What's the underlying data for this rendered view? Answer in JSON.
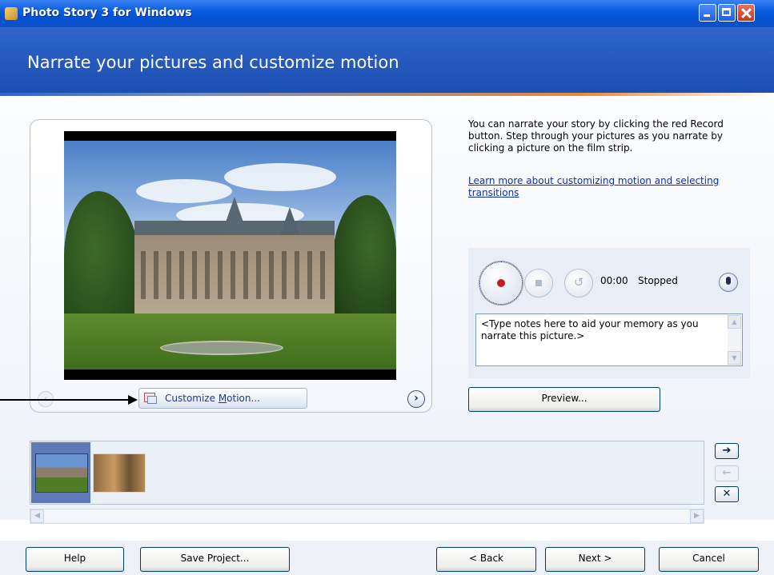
{
  "window": {
    "title": "Photo Story 3 for Windows",
    "controls": {
      "minimize": "minimize-icon",
      "maximize": "maximize-icon",
      "close": "close-icon"
    }
  },
  "header": {
    "title": "Narrate your pictures and customize motion"
  },
  "preview": {
    "customize_label_prefix": "Customize ",
    "customize_label_accel": "M",
    "customize_label_suffix": "otion...",
    "prev_icon": "chevron-left-icon",
    "next_icon": "chevron-right-icon"
  },
  "instructions": {
    "text": "You can narrate your story by clicking the red Record button. Step through your pictures as you narrate by clicking a picture on the film strip.",
    "link": "Learn more about customizing motion and selecting transitions"
  },
  "narration": {
    "time": "00:00",
    "status": "Stopped",
    "notes": "<Type notes here to aid your memory as you narrate this picture.>",
    "record_icon": "record-icon",
    "stop_icon": "stop-icon",
    "undo_icon": "undo-icon",
    "mic_icon": "microphone-icon"
  },
  "preview_button": "Preview...",
  "filmstrip": {
    "selected_index": 0,
    "thumbnails": [
      "castle-thumbnail",
      "interior-thumbnail"
    ],
    "move_right": "➔",
    "move_left": "←",
    "remove": "✕"
  },
  "footer": {
    "help": "Help",
    "save": "Save Project...",
    "back": "< Back",
    "next": "Next >",
    "cancel": "Cancel"
  },
  "colors": {
    "title_bar": "#0553d6",
    "header": "#2f66c7",
    "accent_orange": "#e88a35",
    "record_red": "#c71d1d"
  }
}
